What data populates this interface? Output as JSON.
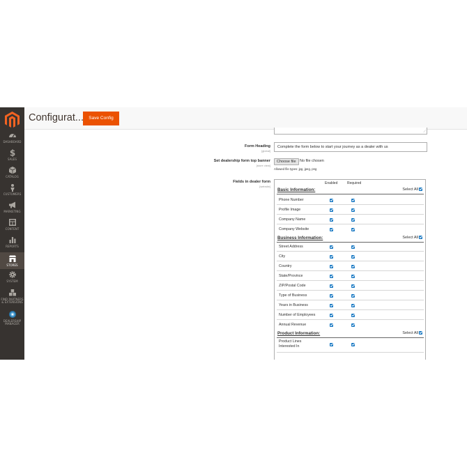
{
  "header": {
    "title": "Configurat...",
    "save_label": "Save Config"
  },
  "sidebar": {
    "items": [
      {
        "label": "DASHBOARD",
        "icon": "dashboard-icon"
      },
      {
        "label": "SALES",
        "icon": "dollar-icon"
      },
      {
        "label": "CATALOG",
        "icon": "box-icon"
      },
      {
        "label": "CUSTOMERS",
        "icon": "person-icon"
      },
      {
        "label": "MARKETING",
        "icon": "megaphone-icon"
      },
      {
        "label": "CONTENT",
        "icon": "layout-icon"
      },
      {
        "label": "REPORTS",
        "icon": "bar-chart-icon"
      },
      {
        "label": "STORES",
        "icon": "store-icon",
        "active": true
      },
      {
        "label": "SYSTEM",
        "icon": "gear-icon"
      },
      {
        "label": "FIND PARTNERS & EXTENSIONS",
        "icon": "cubes-icon"
      },
      {
        "label": "DEALERSHIP MANAGER",
        "icon": "globe-icon"
      }
    ]
  },
  "form": {
    "heading_label": "Form Heading",
    "heading_scope": "[global]",
    "heading_value": "Complete the form below to start your journey as a dealer with us",
    "banner_label": "Set dealership form top banner",
    "banner_scope": "[store view]",
    "choose_file": "Choose file",
    "no_file": "No file chosen",
    "allowed_types": "Allowed file types: jpg, jpeg, png",
    "fields_label": "Fields in dealer form",
    "fields_scope": "[website]"
  },
  "fields_table": {
    "col_enabled": "Enabled",
    "col_required": "Required",
    "select_all": "Select All",
    "sections": [
      {
        "title": "Basic Information:",
        "fields": [
          "Phone Number",
          "Profile Image",
          "Company Name",
          "Company Website"
        ]
      },
      {
        "title": "Business Information:",
        "fields": [
          "Street Address",
          "City",
          "Country",
          "State/Province",
          "ZIP/Postal Code",
          "Type of Business",
          "Years in Business",
          "Number of Employees",
          "Annual Revenue"
        ]
      },
      {
        "title": "Product Information:",
        "fields": [
          "Product Lines Interested In"
        ]
      }
    ]
  },
  "colors": {
    "accent": "#eb5202",
    "sidebar": "#373330",
    "checkbox": "#1979c3"
  }
}
